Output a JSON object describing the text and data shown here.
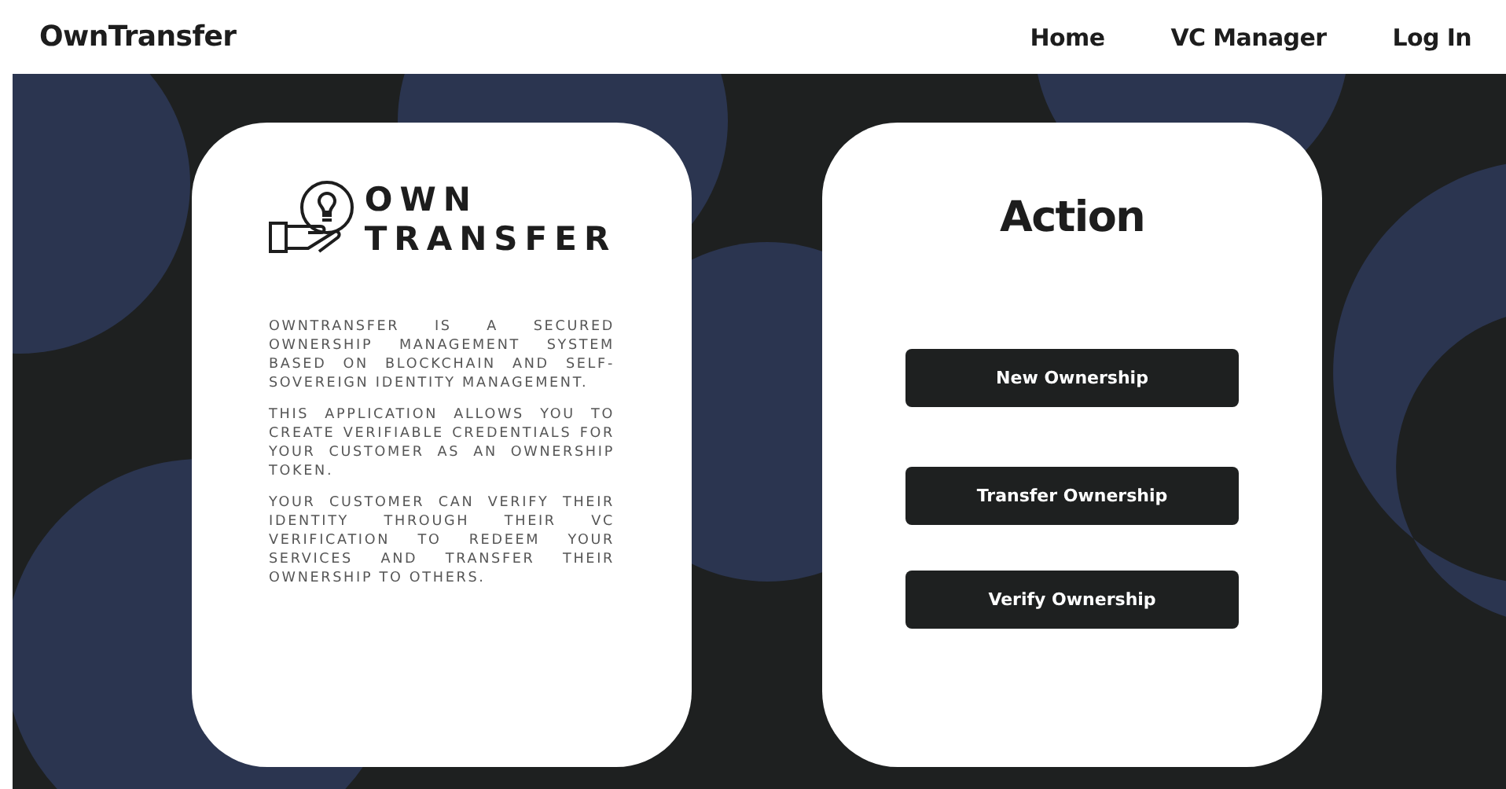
{
  "header": {
    "brand": "OwnTransfer",
    "nav": [
      {
        "label": "Home"
      },
      {
        "label": "VC Manager"
      },
      {
        "label": "Log In"
      }
    ]
  },
  "info_card": {
    "logo": [
      "OWN",
      "TRANSFER"
    ],
    "paragraphs": [
      "OWNTRANSFER IS A SECURED OWNERSHIP MANAGEMENT SYSTEM BASED ON BLOCKCHAIN AND SELF-SOVEREIGN IDENTITY MANAGEMENT.",
      "THIS APPLICATION ALLOWS YOU TO CREATE VERIFIABLE CREDENTIALS FOR YOUR CUSTOMER AS AN OWNERSHIP TOKEN.",
      "YOUR CUSTOMER CAN VERIFY THEIR IDENTITY THROUGH THEIR VC VERIFICATION TO REDEEM YOUR SERVICES AND TRANSFER THEIR OWNERSHIP TO OTHERS."
    ]
  },
  "action_card": {
    "title": "Action",
    "buttons": [
      "New Ownership",
      "Transfer Ownership",
      "Verify Ownership"
    ]
  }
}
